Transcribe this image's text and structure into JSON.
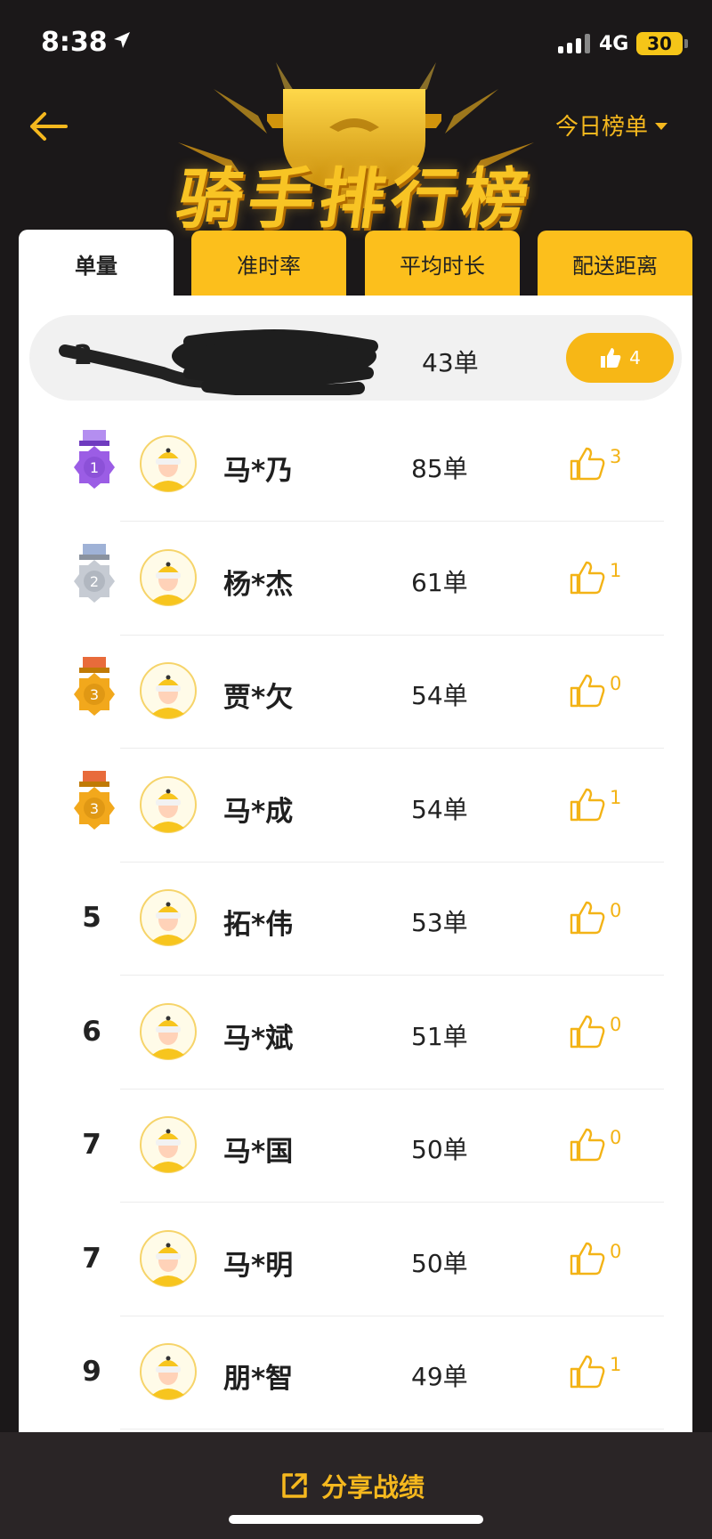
{
  "status": {
    "time": "8:38",
    "network": "4G",
    "battery": "30"
  },
  "header": {
    "title": "骑手排行榜",
    "range_label": "今日榜单"
  },
  "tabs": [
    {
      "label": "单量",
      "active": true
    },
    {
      "label": "准时率",
      "active": false
    },
    {
      "label": "平均时长",
      "active": false
    },
    {
      "label": "配送距离",
      "active": false
    }
  ],
  "me": {
    "count": "43单",
    "likes": "4"
  },
  "rows": [
    {
      "rank": "1",
      "medal": "purple",
      "name": "马*乃",
      "count": "85单",
      "likes": "3"
    },
    {
      "rank": "2",
      "medal": "silver",
      "name": "杨*杰",
      "count": "61单",
      "likes": "1"
    },
    {
      "rank": "3",
      "medal": "gold",
      "name": "贾*欠",
      "count": "54单",
      "likes": "0"
    },
    {
      "rank": "3",
      "medal": "gold",
      "name": "马*成",
      "count": "54单",
      "likes": "1"
    },
    {
      "rank": "5",
      "medal": "",
      "name": "拓*伟",
      "count": "53单",
      "likes": "0"
    },
    {
      "rank": "6",
      "medal": "",
      "name": "马*斌",
      "count": "51单",
      "likes": "0"
    },
    {
      "rank": "7",
      "medal": "",
      "name": "马*国",
      "count": "50单",
      "likes": "0"
    },
    {
      "rank": "7",
      "medal": "",
      "name": "马*明",
      "count": "50单",
      "likes": "0"
    },
    {
      "rank": "9",
      "medal": "",
      "name": "朋*智",
      "count": "49单",
      "likes": "1"
    }
  ],
  "partial_row": {
    "rank": "9"
  },
  "share": {
    "label": "分享战绩"
  },
  "colors": {
    "brand_yellow": "#fcbf1c",
    "accent": "#f5b81e",
    "background": "#1b1819"
  },
  "icons": [
    "location-arrow-icon",
    "back-arrow-icon",
    "dropdown-triangle-icon",
    "thumb-up-icon",
    "medal-icon",
    "avatar-icon",
    "share-icon",
    "trophy-icon"
  ]
}
